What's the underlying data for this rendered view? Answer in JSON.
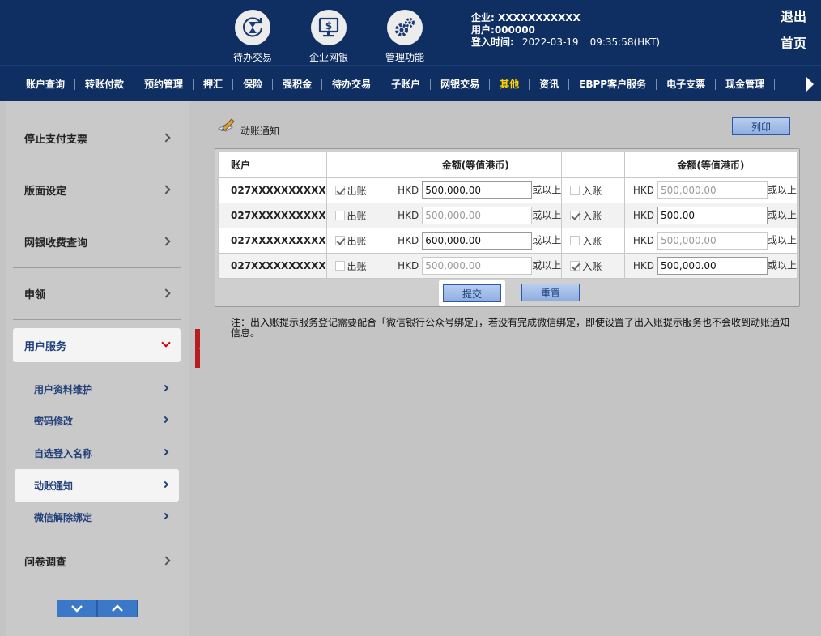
{
  "header": {
    "quick_icons": [
      {
        "label": "待办交易",
        "icon": "hourglass-refresh-icon"
      },
      {
        "label": "企业网银",
        "icon": "monitor-dollar-icon"
      },
      {
        "label": "管理功能",
        "icon": "gears-icon"
      }
    ],
    "company_label": "企业:",
    "company_value": "XXXXXXXXXXX",
    "user_label": "用户:",
    "user_value": "000000",
    "login_label": "登入时间:",
    "login_date": "2022-03-19",
    "login_time": "09:35:58(HKT)",
    "logout": "退出",
    "home": "首页"
  },
  "menu": {
    "items": [
      "账户查询",
      "转账付款",
      "预约管理",
      "押汇",
      "保险",
      "强积金",
      "待办交易",
      "子账户",
      "网银交易",
      "其他",
      "资讯",
      "EBPP客户服务",
      "电子支票",
      "现金管理"
    ],
    "active": "其他"
  },
  "sidebar": {
    "items": [
      {
        "label": "停止支付支票"
      },
      {
        "label": "版面设定"
      },
      {
        "label": "网银收费查询"
      },
      {
        "label": "申领"
      },
      {
        "label": "用户服务"
      },
      {
        "label": "问卷调查"
      }
    ],
    "sub_items": [
      {
        "label": "用户资料维护"
      },
      {
        "label": "密码修改"
      },
      {
        "label": "自选登入名称"
      },
      {
        "label": "动账通知"
      },
      {
        "label": "微信解除绑定"
      }
    ]
  },
  "page": {
    "title": "动账通知",
    "print": "列印",
    "submit": "提交",
    "reset": "重置",
    "note": "注：出入账提示服务登记需要配合「微信银行公众号绑定」，若没有完成微信绑定，即使设置了出入账提示服务也不会收到动账通知信息。"
  },
  "table": {
    "headers": [
      "账户",
      "",
      "金额(等值港币)",
      "",
      "金额(等值港币)"
    ],
    "out_label": "出账",
    "in_label": "入账",
    "currency": "HKD",
    "suffix": "或以上",
    "rows": [
      {
        "account": "027XXXXXXXXXX",
        "out_checked": true,
        "out_amount": "500,000.00",
        "in_checked": false,
        "in_amount": "500,000.00"
      },
      {
        "account": "027XXXXXXXXXX",
        "out_checked": false,
        "out_amount": "500,000.00",
        "in_checked": true,
        "in_amount": "500.00"
      },
      {
        "account": "027XXXXXXXXXX",
        "out_checked": true,
        "out_amount": "600,000.00",
        "in_checked": false,
        "in_amount": "500,000.00"
      },
      {
        "account": "027XXXXXXXXXX",
        "out_checked": false,
        "out_amount": "500,000.00",
        "in_checked": true,
        "in_amount": "500,000.00"
      }
    ]
  },
  "colors": {
    "header_bg": "#0f2f62",
    "menu_active": "#ffd400",
    "accent_button": "#3c78c8",
    "collapse_tab": "#b91c1c"
  }
}
